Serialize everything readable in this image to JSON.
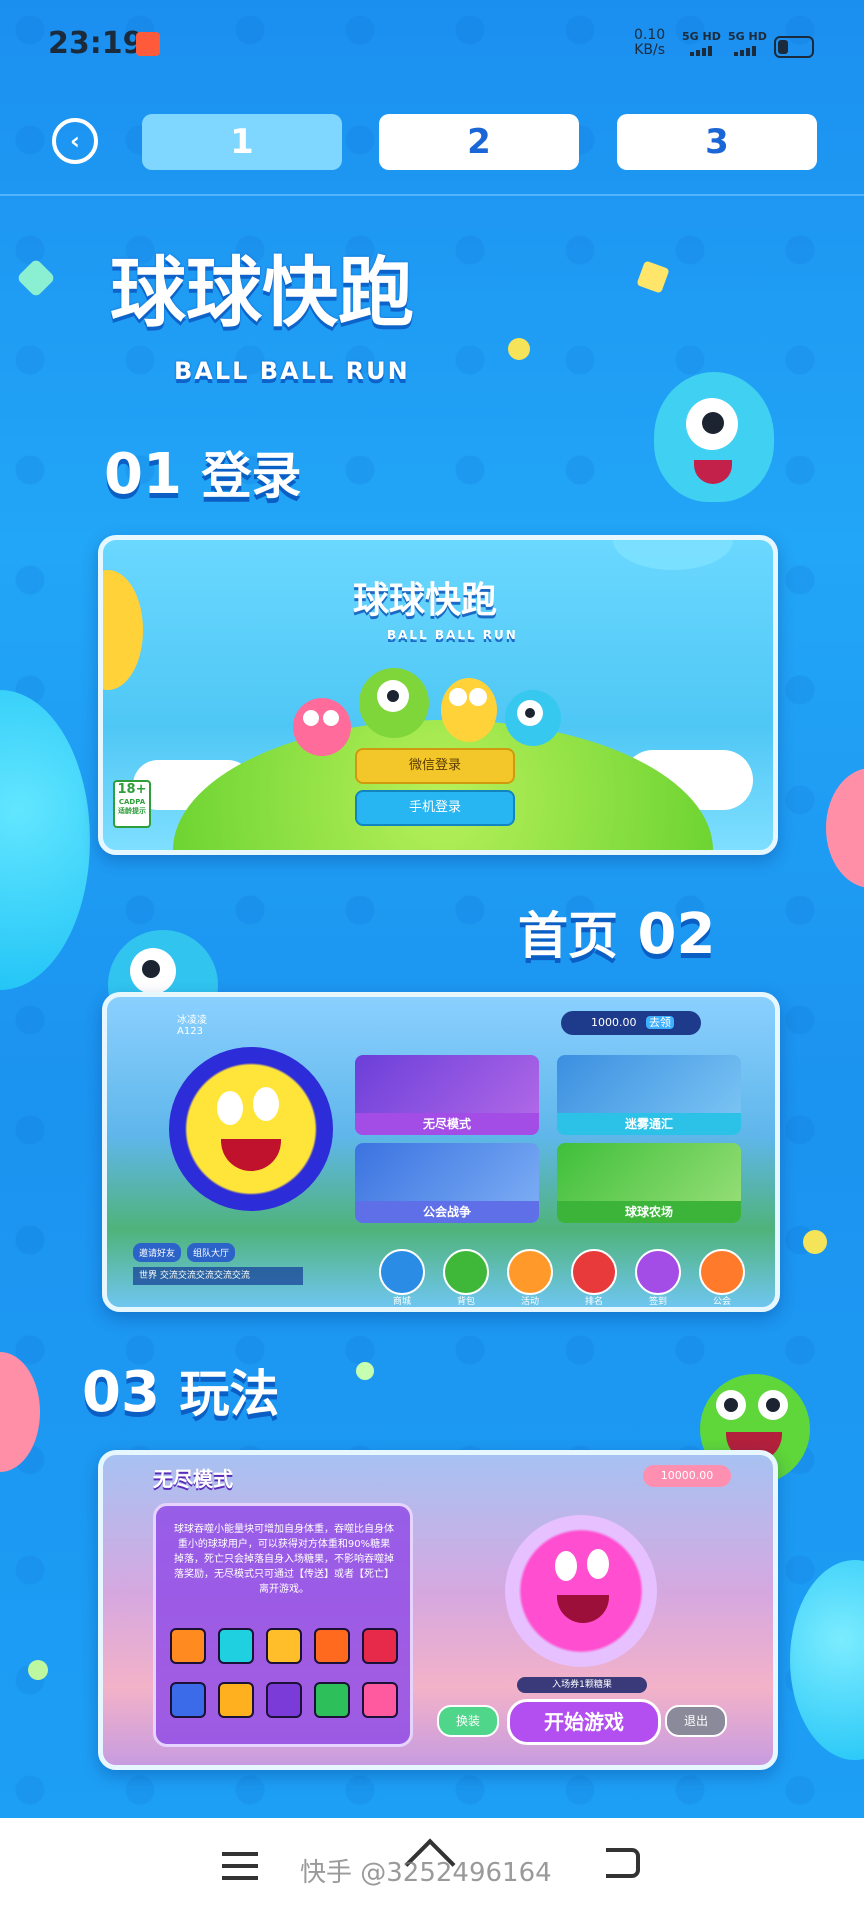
{
  "status": {
    "time": "23:19",
    "net_speed": "0.10",
    "net_unit": "KB/s",
    "sim1": "5G HD",
    "sim2": "5G HD"
  },
  "nav": {
    "back_icon": "back-arrow-icon",
    "tabs": [
      {
        "label": "1",
        "active": true
      },
      {
        "label": "2",
        "active": false
      },
      {
        "label": "3",
        "active": false
      }
    ]
  },
  "hero": {
    "title": "球球快跑",
    "subtitle": "BALL BALL RUN"
  },
  "sections": [
    {
      "num": "01",
      "title": "登录"
    },
    {
      "num": "02",
      "title": "首页"
    },
    {
      "num": "03",
      "title": "玩法"
    }
  ],
  "login": {
    "logo": "球球快跑",
    "logo_sub": "BALL BALL RUN",
    "wechat_btn": "微信登录",
    "phone_btn": "手机登录",
    "age_badge": "18+",
    "age_sub": "CADPA",
    "age_note": "适龄提示"
  },
  "home": {
    "nickname": "冰凌凌",
    "id": "A123",
    "coins": "1000.00",
    "coin_btn": "去领",
    "modes": [
      "无尽模式",
      "迷雾通汇",
      "公会战争",
      "球球农场"
    ],
    "invite": "邀请好友",
    "team": "组队大厅",
    "chat_channel": "世界",
    "chat_text": "交流交流交流交流交流",
    "icons": [
      "商城",
      "背包",
      "活动",
      "排名",
      "签到",
      "公会"
    ]
  },
  "play": {
    "mode_title": "无尽模式",
    "coins": "10000.00",
    "description": "球球吞噬小能量块可增加自身体重，吞噬比自身体重小的球球用户，可以获得对方体重和90%糖果掉落，死亡只会掉落自身入场糖果，不影响吞噬掉落奖励，无尽模式只可通过【传送】或者【死亡】离开游戏。",
    "ticket": "入场券1颗糖果",
    "swap_btn": "换装",
    "start_btn": "开始游戏",
    "exit_btn": "退出"
  },
  "bottom": {
    "menu_icon": "menu-icon",
    "home_icon": "home-icon",
    "back_icon": "back-icon",
    "watermark": "快手 @3252496164"
  },
  "colors": {
    "background": "#1b93f0",
    "tab_active": "#7fd6ff",
    "tab_text": "#1b66d6",
    "wechat": "#f3c72a",
    "phone": "#27b6f2",
    "start": "#b34ef0"
  }
}
